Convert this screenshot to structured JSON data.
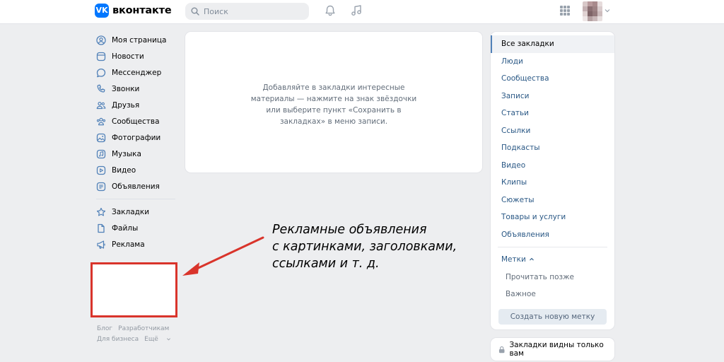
{
  "header": {
    "logo_mark": "VK",
    "logo_text": "вконтакте",
    "search_placeholder": "Поиск",
    "icons": [
      "search-icon",
      "bell-icon",
      "music-icon",
      "apps-grid-icon",
      "chevron-down-icon"
    ]
  },
  "left_nav": {
    "items": [
      {
        "label": "Моя страница",
        "icon": "user-circle-icon"
      },
      {
        "label": "Новости",
        "icon": "news-icon"
      },
      {
        "label": "Мессенджер",
        "icon": "message-icon"
      },
      {
        "label": "Звонки",
        "icon": "phone-icon"
      },
      {
        "label": "Друзья",
        "icon": "friends-icon"
      },
      {
        "label": "Сообщества",
        "icon": "communities-icon"
      },
      {
        "label": "Фотографии",
        "icon": "photo-icon"
      },
      {
        "label": "Музыка",
        "icon": "music-icon"
      },
      {
        "label": "Видео",
        "icon": "video-icon"
      },
      {
        "label": "Объявления",
        "icon": "classifieds-icon"
      }
    ],
    "items2": [
      {
        "label": "Закладки",
        "icon": "star-icon"
      },
      {
        "label": "Файлы",
        "icon": "file-icon"
      },
      {
        "label": "Реклама",
        "icon": "megaphone-icon"
      }
    ],
    "footer": {
      "blog": "Блог",
      "developers": "Разработчикам",
      "business": "Для бизнеса",
      "more": "Ещё"
    }
  },
  "center": {
    "empty_text": "Добавляйте в закладки интересные материалы — нажмите на знак звёздочки или выберите пункт «Сохранить в закладках» в меню записи."
  },
  "right_menu": {
    "items": [
      {
        "label": "Все закладки",
        "active": true
      },
      {
        "label": "Люди"
      },
      {
        "label": "Сообщества"
      },
      {
        "label": "Записи"
      },
      {
        "label": "Статьи"
      },
      {
        "label": "Ссылки"
      },
      {
        "label": "Подкасты"
      },
      {
        "label": "Видео"
      },
      {
        "label": "Клипы"
      },
      {
        "label": "Сюжеты"
      },
      {
        "label": "Товары и услуги"
      },
      {
        "label": "Объявления"
      }
    ],
    "tags_title": "Метки",
    "tags": [
      "Прочитать позже",
      "Важное"
    ],
    "create_tag_button": "Создать новую метку",
    "privacy_note": "Закладки видны только вам"
  },
  "annotation": {
    "lines": [
      "Рекламные объявления",
      "с картинками, заголовками,",
      "ссылками и т. д."
    ],
    "color": "#d9342b"
  },
  "colors": {
    "accent": "#0077ff",
    "link": "#2a5885",
    "background": "#edeef0",
    "highlight_border": "#d9342b"
  }
}
